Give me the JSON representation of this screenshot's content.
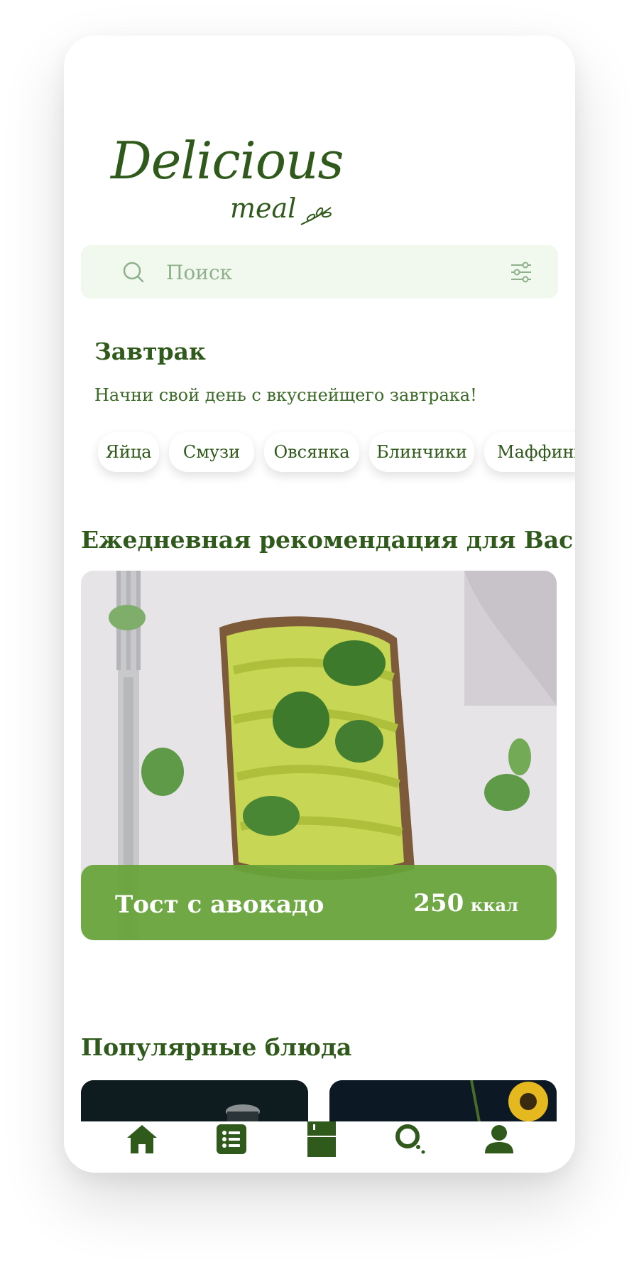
{
  "logo": {
    "main": "Delicious",
    "sub": "meal"
  },
  "search": {
    "placeholder": "Поиск"
  },
  "breakfast": {
    "title": "Завтрак",
    "subtitle": "Начни свой день с вкуснейщего завтрака!",
    "chips": [
      "Яйца",
      "Смузи",
      "Овсянка",
      "Блинчики",
      "Маффины"
    ]
  },
  "daily": {
    "title": "Ежедневная рекомендация для Вас",
    "dish_name": "Тост с авокадо",
    "calories": "250",
    "calories_unit": "ккал"
  },
  "popular": {
    "title": "Популярные блюда"
  },
  "tabbar": {
    "items": [
      "home-icon",
      "list-icon",
      "fridge-icon",
      "search-icon",
      "profile-icon"
    ]
  },
  "colors": {
    "primary": "#2f5a1b",
    "accent": "#67a439",
    "search_bg": "#f1f9ee"
  }
}
